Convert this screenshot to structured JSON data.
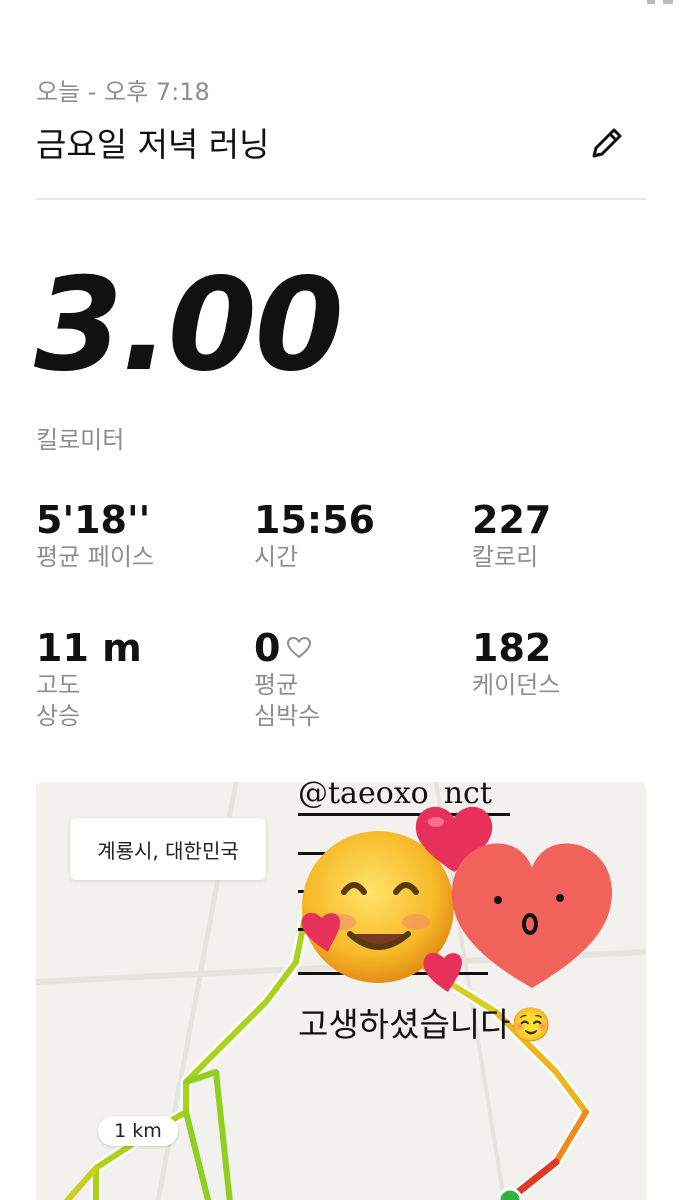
{
  "header": {
    "date_time": "오늘 - 오후 7:18",
    "title": "금요일 저녁 러닝",
    "edit_icon": "pencil-icon"
  },
  "summary": {
    "distance": "3.00",
    "distance_unit": "킬로미터"
  },
  "stats": [
    {
      "value": "5'18''",
      "label": "평균 페이스"
    },
    {
      "value": "15:56",
      "label": "시간"
    },
    {
      "value": "227",
      "label": "칼로리"
    },
    {
      "value": "11 m",
      "label_line1": "고도",
      "label_line2": "상승"
    },
    {
      "value": "0",
      "label_line1": "평균",
      "label_line2": "심박수",
      "icon": "heart-outline-icon"
    },
    {
      "value": "182",
      "label": "케이던스"
    }
  ],
  "map": {
    "location": "계룡시, 대한민국",
    "scale_label": "1 km",
    "route_colors": [
      "#9bd11c",
      "#e9c81e",
      "#f08a1c",
      "#e23a22"
    ]
  },
  "overlay": {
    "handle": "@taeoxo_nct",
    "message": "고생하셨습니다☺️",
    "stickers": [
      "smiling-face-with-hearts-emoji",
      "heart-emoji",
      "red-heart-face-sticker"
    ]
  }
}
